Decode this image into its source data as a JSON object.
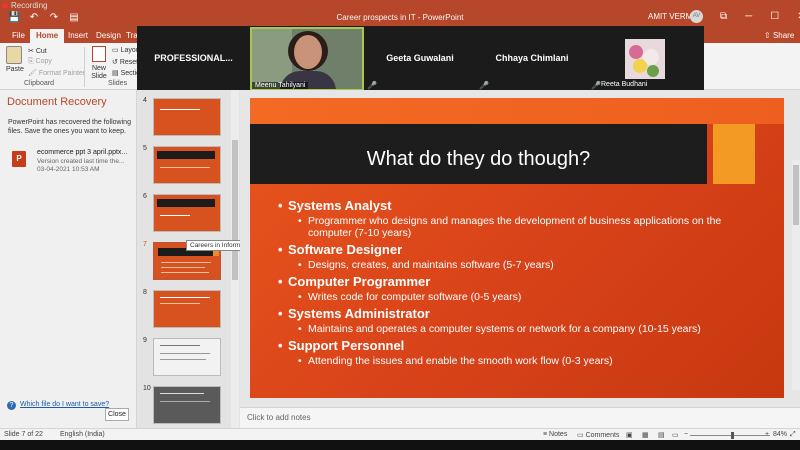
{
  "window": {
    "recording_label": "Recording",
    "title": "Career prospects in IT  -  PowerPoint",
    "user_name": "AMIT VERMA",
    "user_initials": "AV",
    "qat": {
      "save": "💾",
      "undo": "↶",
      "redo": "↷",
      "present": "▤"
    },
    "controls": {
      "restore": "⧉",
      "minimize": "─",
      "maximize": "☐",
      "close": "✕"
    }
  },
  "tabs": [
    {
      "label": "File"
    },
    {
      "label": "Home"
    },
    {
      "label": "Insert"
    },
    {
      "label": "Design"
    },
    {
      "label": "Tran"
    }
  ],
  "share_label": "Share",
  "ribbon": {
    "paste": "Paste",
    "cut": "Cut",
    "copy": "Copy",
    "format_painter": "Format Painter",
    "clipboard_group": "Clipboard",
    "new_slide": "New Slide",
    "layout": "Layout",
    "reset": "Reset",
    "section": "Section",
    "slides_group": "Slides"
  },
  "meeting": {
    "tiles": [
      {
        "name": "PROFESSIONAL..."
      },
      {
        "name": "Geeta Guwalani"
      },
      {
        "name": "Chhaya Chimlani"
      }
    ],
    "camera_label": "Meenu Tahilyani",
    "photo_label": "Reeta Budhani",
    "mic_off_icon": "🎤"
  },
  "recovery": {
    "title": "Document Recovery",
    "description": "PowerPoint has recovered the following files.  Save the ones you want to keep.",
    "file_name": "ecommerce ppt 3 april.pptx...",
    "file_meta": "Version created last time the...",
    "file_date": "03-04-2021 10:53 AM",
    "help_link": "Which file do I want to save?",
    "close_label": "Close"
  },
  "thumbnails": {
    "numbers": [
      "4",
      "5",
      "6",
      "7",
      "8",
      "9",
      "10"
    ],
    "tooltip": "Careers in Information Technol..."
  },
  "slide": {
    "title": "What do they do though?",
    "points": [
      {
        "heading": "Systems Analyst",
        "detail": "Programmer who designs and manages the development of business applications on the computer (7-10 years)"
      },
      {
        "heading": "Software Designer",
        "detail": "Designs, creates, and maintains software (5-7 years)"
      },
      {
        "heading": "Computer Programmer",
        "detail": "Writes code for computer software (0-5 years)"
      },
      {
        "heading": "Systems Administrator",
        "detail": "Maintains and operates a computer systems or network for a company (10-15 years)"
      },
      {
        "heading": "Support Personnel",
        "detail": "Attending the issues and enable the smooth work flow (0-3 years)"
      }
    ],
    "notes_placeholder": "Click to add notes"
  },
  "status": {
    "slide_indicator": "Slide 7 of 22",
    "language": "English (India)",
    "notes": "Notes",
    "comments": "Comments",
    "zoom": "84%",
    "zoom_minus": "−",
    "zoom_plus": "+"
  },
  "colors": {
    "brand": "#b7472a",
    "slide_orange": "#e8561c",
    "title_bar": "#1d1d1d",
    "accent_square": "#f39a24"
  }
}
